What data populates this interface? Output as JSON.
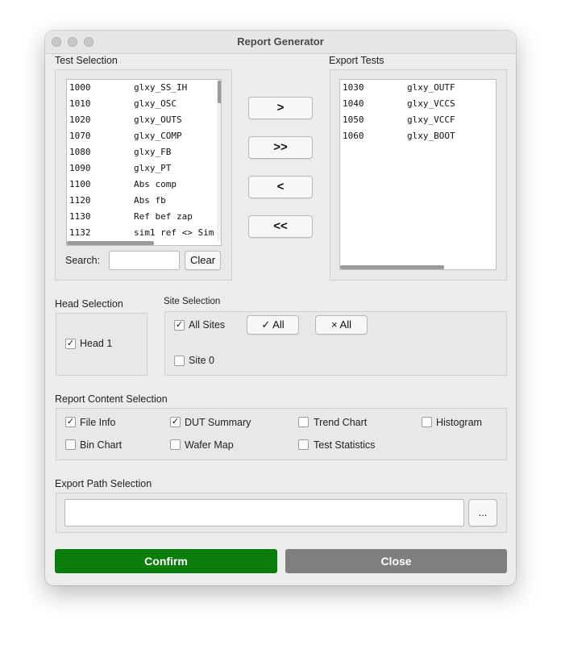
{
  "window": {
    "title": "Report Generator"
  },
  "test_selection": {
    "label": "Test Selection",
    "rows": [
      {
        "id": "1000",
        "name": "glxy_SS_IH"
      },
      {
        "id": "1010",
        "name": "glxy_OSC"
      },
      {
        "id": "1020",
        "name": "glxy_OUTS"
      },
      {
        "id": "1070",
        "name": "glxy_COMP"
      },
      {
        "id": "1080",
        "name": "glxy_FB"
      },
      {
        "id": "1090",
        "name": "glxy_PT"
      },
      {
        "id": "1100",
        "name": "Abs comp"
      },
      {
        "id": "1120",
        "name": "Abs fb"
      },
      {
        "id": "1130",
        "name": "Ref bef zap"
      },
      {
        "id": "1132",
        "name": "sim1 ref <> Sim"
      }
    ],
    "search_label": "Search:",
    "search_value": "",
    "clear_label": "Clear"
  },
  "transfer_buttons": {
    "add": ">",
    "add_all": ">>",
    "remove": "<",
    "remove_all": "<<"
  },
  "export_tests": {
    "label": "Export Tests",
    "rows": [
      {
        "id": "1030",
        "name": "glxy_OUTF"
      },
      {
        "id": "1040",
        "name": "glxy_VCCS"
      },
      {
        "id": "1050",
        "name": "glxy_VCCF"
      },
      {
        "id": "1060",
        "name": "glxy_BOOT"
      }
    ]
  },
  "head_selection": {
    "label": "Head Selection",
    "head1": {
      "label": "Head 1",
      "checked": true
    }
  },
  "site_selection": {
    "label": "Site Selection",
    "all_sites": {
      "label": "All Sites",
      "checked": true
    },
    "check_all_label": "✓ All",
    "uncheck_all_label": "× All",
    "site0": {
      "label": "Site 0",
      "checked": false
    }
  },
  "report_content": {
    "label": "Report Content Selection",
    "file_info": {
      "label": "File Info",
      "checked": true
    },
    "dut_summary": {
      "label": "DUT Summary",
      "checked": true
    },
    "trend_chart": {
      "label": "Trend Chart",
      "checked": false
    },
    "histogram": {
      "label": "Histogram",
      "checked": false
    },
    "bin_chart": {
      "label": "Bin Chart",
      "checked": false
    },
    "wafer_map": {
      "label": "Wafer Map",
      "checked": false
    },
    "test_statistics": {
      "label": "Test Statistics",
      "checked": false
    }
  },
  "export_path": {
    "label": "Export Path Selection",
    "value": "",
    "browse_label": "..."
  },
  "actions": {
    "confirm_label": "Confirm",
    "close_label": "Close"
  },
  "colors": {
    "confirm": "#0a7d0a",
    "close": "#7f7f7f"
  },
  "check_mark": "✓"
}
